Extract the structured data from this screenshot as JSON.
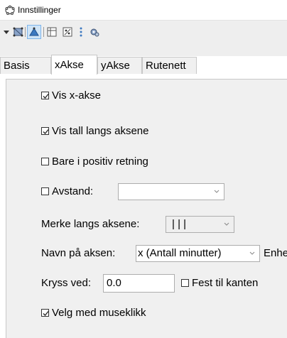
{
  "window": {
    "title": "Innstillinger"
  },
  "toolbar": {
    "icons": [
      "dropdown-arrow-icon",
      "graphics-view-icon",
      "geometry-view-icon",
      "table-view-icon",
      "algebra-view-icon",
      "more-dots-icon",
      "settings-icon"
    ]
  },
  "tabs": [
    {
      "label": "Basis",
      "active": false
    },
    {
      "label": "xAkse",
      "active": true
    },
    {
      "label": "yAkse",
      "active": false
    },
    {
      "label": "Rutenett",
      "active": false
    }
  ],
  "settings": {
    "show_axis": {
      "label": "Vis x-akse",
      "checked": true
    },
    "show_numbers": {
      "label": "Vis tall langs aksene",
      "checked": true
    },
    "positive_only": {
      "label": "Bare i positiv retning",
      "checked": false
    },
    "distance": {
      "label": "Avstand:",
      "checked": false,
      "value": ""
    },
    "ticks": {
      "label": "Merke langs aksene:",
      "value": "|  |  |"
    },
    "axis_name": {
      "label": "Navn på aksen:",
      "value": "x (Antall minutter)",
      "unit_label": "Enhe"
    },
    "cross_at": {
      "label": "Kryss ved:",
      "value": "0.0"
    },
    "fix_to_edge": {
      "label": "Fest til kanten",
      "checked": false
    },
    "select_with_click": {
      "label": "Velg med museklikk",
      "checked": true
    }
  }
}
